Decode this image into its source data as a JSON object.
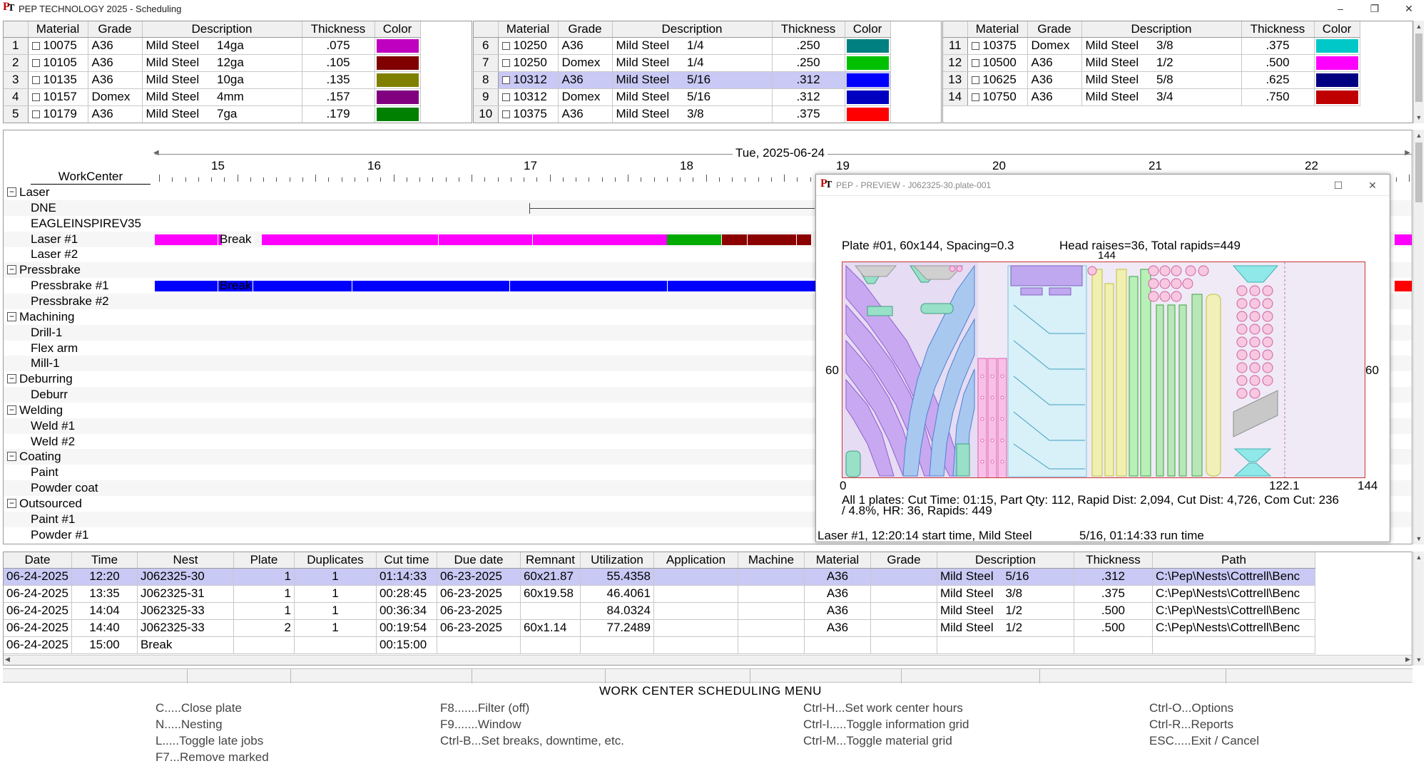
{
  "window": {
    "title": "PEP TECHNOLOGY 2025 - Scheduling",
    "min": "–",
    "max": "❐",
    "close": "✕"
  },
  "material_headers": [
    "Material",
    "Grade",
    "Description",
    "",
    "Thickness",
    "Color"
  ],
  "material_grids": [
    {
      "rows": [
        {
          "n": "1",
          "mat": "10075",
          "grade": "A36",
          "desc": "Mild Steel",
          "size": "14ga",
          "thk": ".075",
          "color": "#c000c0"
        },
        {
          "n": "2",
          "mat": "10105",
          "grade": "A36",
          "desc": "Mild Steel",
          "size": "12ga",
          "thk": ".105",
          "color": "#800000"
        },
        {
          "n": "3",
          "mat": "10135",
          "grade": "A36",
          "desc": "Mild Steel",
          "size": "10ga",
          "thk": ".135",
          "color": "#808000"
        },
        {
          "n": "4",
          "mat": "10157",
          "grade": "Domex",
          "desc": "Mild Steel",
          "size": "4mm",
          "thk": ".157",
          "color": "#800080"
        },
        {
          "n": "5",
          "mat": "10179",
          "grade": "A36",
          "desc": "Mild Steel",
          "size": "7ga",
          "thk": ".179",
          "color": "#008000"
        }
      ]
    },
    {
      "rows": [
        {
          "n": "6",
          "mat": "10250",
          "grade": "A36",
          "desc": "Mild Steel",
          "size": "1/4",
          "thk": ".250",
          "color": "#008080"
        },
        {
          "n": "7",
          "mat": "10250",
          "grade": "Domex",
          "desc": "Mild Steel",
          "size": "1/4",
          "thk": ".250",
          "color": "#00c000"
        },
        {
          "n": "8",
          "mat": "10312",
          "grade": "A36",
          "desc": "Mild Steel",
          "size": "5/16",
          "thk": ".312",
          "color": "#0000ff",
          "selected": true
        },
        {
          "n": "9",
          "mat": "10312",
          "grade": "Domex",
          "desc": "Mild Steel",
          "size": "5/16",
          "thk": ".312",
          "color": "#0000c0"
        },
        {
          "n": "10",
          "mat": "10375",
          "grade": "A36",
          "desc": "Mild Steel",
          "size": "3/8",
          "thk": ".375",
          "color": "#ff0000"
        }
      ]
    },
    {
      "rows": [
        {
          "n": "11",
          "mat": "10375",
          "grade": "Domex",
          "desc": "Mild Steel",
          "size": "3/8",
          "thk": ".375",
          "color": "#00c8c8"
        },
        {
          "n": "12",
          "mat": "10500",
          "grade": "A36",
          "desc": "Mild Steel",
          "size": "1/2",
          "thk": ".500",
          "color": "#ff00ff"
        },
        {
          "n": "13",
          "mat": "10625",
          "grade": "A36",
          "desc": "Mild Steel",
          "size": "5/8",
          "thk": ".625",
          "color": "#000080"
        },
        {
          "n": "14",
          "mat": "10750",
          "grade": "A36",
          "desc": "Mild Steel",
          "size": "3/4",
          "thk": ".750",
          "color": "#c00000"
        }
      ]
    }
  ],
  "gantt": {
    "date": "Tue, 2025-06-24",
    "workcenter_header": "WorkCenter",
    "hours": [
      "15",
      "16",
      "17",
      "18",
      "19",
      "20",
      "21",
      "22"
    ],
    "break_label": "Break",
    "rows": [
      {
        "label": "Laser",
        "group": true,
        "toggle": "−"
      },
      {
        "label": "DNE"
      },
      {
        "label": "EAGLEINSPIREV35"
      },
      {
        "label": "Laser #1"
      },
      {
        "label": "Laser #2"
      },
      {
        "label": "Pressbrake",
        "group": true,
        "toggle": "−"
      },
      {
        "label": "Pressbrake #1"
      },
      {
        "label": "Pressbrake #2"
      },
      {
        "label": "Machining",
        "group": true,
        "toggle": "−"
      },
      {
        "label": "Drill-1"
      },
      {
        "label": "Flex arm"
      },
      {
        "label": "Mill-1"
      },
      {
        "label": "Deburring",
        "group": true,
        "toggle": "−"
      },
      {
        "label": "Deburr"
      },
      {
        "label": "Welding",
        "group": true,
        "toggle": "−"
      },
      {
        "label": "Weld #1"
      },
      {
        "label": "Weld #2"
      },
      {
        "label": "Coating",
        "group": true,
        "toggle": "−"
      },
      {
        "label": "Paint"
      },
      {
        "label": "Powder coat"
      },
      {
        "label": "Outsourced",
        "group": true,
        "toggle": "−"
      },
      {
        "label": "Paint #1"
      },
      {
        "label": "Powder #1"
      }
    ]
  },
  "preview": {
    "title": "PEP - PREVIEW - J062325-30.plate-001",
    "plate_info": "Plate #01, 60x144, Spacing=0.3",
    "head_info": "Head raises=36, Total rapids=449",
    "dim_top": "144",
    "dim_left": "60",
    "dim_right": "60",
    "dim_bottom_0": "0",
    "dim_bottom_used": "122.1",
    "dim_bottom_144": "144",
    "summary_line1": "All 1 plates: Cut Time: 01:15, Part Qty: 112, Rapid Dist: 2,094, Cut Dist: 4,726, Com Cut: 236",
    "summary_line2": "/ 4.8%, HR: 36, Rapids: 449",
    "status_left": "Laser #1, 12:20:14 start time, Mild Steel",
    "status_right": "5/16, 01:14:33 run time"
  },
  "info_grid": {
    "headers": [
      "Date",
      "Time",
      "Nest",
      "Plate",
      "Duplicates",
      "Cut time",
      "Due date",
      "Remnant",
      "Utilization",
      "Application",
      "Machine",
      "Material",
      "Grade",
      "Description",
      "",
      "Thickness",
      "Path"
    ],
    "rows": [
      {
        "date": "06-24-2025",
        "time": "12:20",
        "nest": "J062325-30",
        "plate": "1",
        "dup": "1",
        "cut": "01:14:33",
        "due": "06-23-2025",
        "rem": "60x21.87",
        "util": "55.4358",
        "app": "",
        "mach": "",
        "mat": "A36",
        "grade": "",
        "desc": "Mild Steel",
        "size": "5/16",
        "thk": ".312",
        "path": "C:\\Pep\\Nests\\Cottrell\\Benc",
        "selected": true
      },
      {
        "date": "06-24-2025",
        "time": "13:35",
        "nest": "J062325-31",
        "plate": "1",
        "dup": "1",
        "cut": "00:28:45",
        "due": "06-23-2025",
        "rem": "60x19.58",
        "util": "46.4061",
        "app": "",
        "mach": "",
        "mat": "A36",
        "grade": "",
        "desc": "Mild Steel",
        "size": "3/8",
        "thk": ".375",
        "path": "C:\\Pep\\Nests\\Cottrell\\Benc"
      },
      {
        "date": "06-24-2025",
        "time": "14:04",
        "nest": "J062325-33",
        "plate": "1",
        "dup": "1",
        "cut": "00:36:34",
        "due": "06-23-2025",
        "rem": "",
        "util": "84.0324",
        "app": "",
        "mach": "",
        "mat": "A36",
        "grade": "",
        "desc": "Mild Steel",
        "size": "1/2",
        "thk": ".500",
        "path": "C:\\Pep\\Nests\\Cottrell\\Benc"
      },
      {
        "date": "06-24-2025",
        "time": "14:40",
        "nest": "J062325-33",
        "plate": "2",
        "dup": "1",
        "cut": "00:19:54",
        "due": "06-23-2025",
        "rem": "60x1.14",
        "util": "77.2489",
        "app": "",
        "mach": "",
        "mat": "A36",
        "grade": "",
        "desc": "Mild Steel",
        "size": "1/2",
        "thk": ".500",
        "path": "C:\\Pep\\Nests\\Cottrell\\Benc"
      },
      {
        "date": "06-24-2025",
        "time": "15:00",
        "nest": "Break",
        "plate": "",
        "dup": "",
        "cut": "00:15:00",
        "due": "",
        "rem": "",
        "util": "",
        "app": "",
        "mach": "",
        "mat": "",
        "grade": "",
        "desc": "",
        "size": "",
        "thk": "",
        "path": ""
      }
    ]
  },
  "menu": {
    "title": "WORK CENTER SCHEDULING MENU",
    "col1": [
      "C.....Close plate",
      "N.....Nesting",
      "L.....Toggle late jobs",
      "F7...Remove marked"
    ],
    "col2": [
      "F8.......Filter (off)",
      "F9.......Window",
      "Ctrl-B...Set breaks, downtime, etc."
    ],
    "col3": [
      "Ctrl-H...Set work center hours",
      "Ctrl-I.....Toggle information grid",
      "Ctrl-M...Toggle material grid"
    ],
    "col4": [
      "Ctrl-O...Options",
      "Ctrl-R...Reports",
      "ESC.....Exit / Cancel"
    ]
  }
}
